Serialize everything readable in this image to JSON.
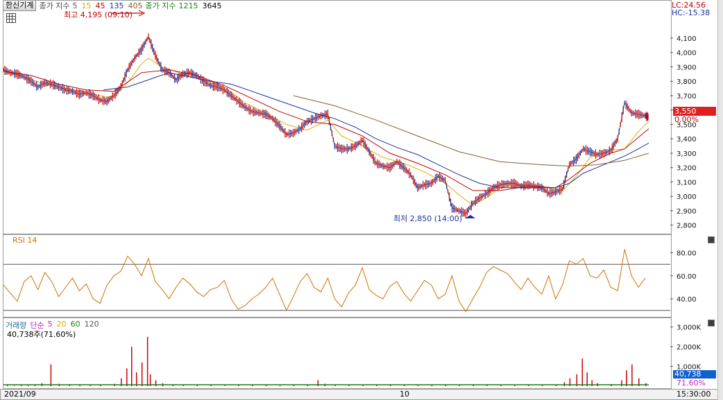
{
  "header": {
    "stock_button": "한신기계",
    "indicator_label": "종가 지수",
    "ma_periods": [
      {
        "text": "5",
        "color": "#555555"
      },
      {
        "text": "15",
        "color": "#d9b000"
      },
      {
        "text": "45",
        "color": "#c00000"
      },
      {
        "text": "135",
        "color": "#1a2fa0"
      },
      {
        "text": "405",
        "color": "#8a5a2a"
      }
    ],
    "indicator_label2": "종가 지수",
    "ma_periods2": [
      {
        "text": "1215",
        "color": "#1a7a1a"
      },
      {
        "text": "3645",
        "color": "#000000"
      }
    ]
  },
  "price_annotations": {
    "high": "최고 4,195 (09:10)",
    "low": "최저 2,850 (14:00)",
    "lc": "LC:24.56",
    "hc": "HC:-15.38",
    "current_price": "3,550",
    "current_change": "0.00%"
  },
  "rsi": {
    "title": "RSI 14"
  },
  "volume": {
    "title": "거래량",
    "ma_label": "단순",
    "ma_periods": [
      {
        "text": "5",
        "color": "#c020c0"
      },
      {
        "text": "20",
        "color": "#d9b000"
      },
      {
        "text": "60",
        "color": "#1a7a1a"
      },
      {
        "text": "120",
        "color": "#555555"
      }
    ],
    "current_volume": "40,738주(71.60%)",
    "current_badge": "40,738",
    "current_pct": "71.60%"
  },
  "x_axis": {
    "start": "2021/09",
    "mid": "10",
    "end": "15:30:00"
  },
  "chart_data": [
    {
      "type": "line",
      "title": "",
      "ylim": [
        2760,
        4230
      ],
      "y_ticks": [
        "4,100",
        "4,000",
        "3,900",
        "3,800",
        "3,700",
        "3,600",
        "3,500",
        "3,400",
        "3,300",
        "3,200",
        "3,100",
        "3,000",
        "2,900",
        "2,800"
      ],
      "series": [
        {
          "name": "5",
          "color": "#7a7a7a",
          "x": [
            0,
            10,
            20,
            30,
            40,
            50,
            60,
            70,
            80,
            90,
            100,
            110,
            120,
            130,
            140,
            150,
            160,
            170,
            180,
            190,
            200,
            210,
            220,
            230,
            240,
            250,
            260,
            270,
            280,
            290,
            300,
            310,
            320,
            330,
            340,
            350,
            360,
            370,
            380,
            390,
            400,
            410,
            420,
            430,
            440,
            450,
            460,
            470,
            480,
            490,
            500,
            510,
            520,
            530,
            540,
            550,
            560,
            570,
            580,
            590,
            600,
            610,
            620,
            630,
            640,
            650,
            660,
            670,
            680,
            690,
            700,
            710,
            720,
            730,
            740,
            750,
            760,
            770,
            780,
            790,
            800,
            810,
            820,
            830,
            840,
            850,
            860,
            870,
            880,
            890,
            900,
            910,
            920,
            930,
            935
          ],
          "values": [
            3880,
            3860,
            3850,
            3830,
            3800,
            3760,
            3790,
            3780,
            3760,
            3740,
            3730,
            3710,
            3720,
            3700,
            3670,
            3660,
            3700,
            3760,
            3880,
            3960,
            4020,
            4110,
            3980,
            3880,
            3860,
            3810,
            3850,
            3860,
            3840,
            3800,
            3770,
            3760,
            3740,
            3700,
            3660,
            3620,
            3590,
            3580,
            3570,
            3540,
            3490,
            3430,
            3440,
            3470,
            3520,
            3540,
            3560,
            3570,
            3350,
            3330,
            3330,
            3350,
            3390,
            3310,
            3230,
            3210,
            3200,
            3240,
            3200,
            3150,
            3060,
            3080,
            3090,
            3140,
            3110,
            2920,
            2900,
            2880,
            2950,
            2990,
            3020,
            3060,
            3080,
            3090,
            3090,
            3070,
            3080,
            3070,
            3060,
            3020,
            3030,
            3050,
            3220,
            3260,
            3330,
            3310,
            3290,
            3300,
            3320,
            3400,
            3650,
            3580,
            3570,
            3560,
            3550
          ]
        },
        {
          "name": "15",
          "color": "#d9b000",
          "x": [
            0,
            30,
            60,
            90,
            120,
            150,
            160,
            180,
            200,
            210,
            230,
            260,
            290,
            320,
            350,
            380,
            410,
            440,
            470,
            490,
            520,
            550,
            580,
            610,
            640,
            660,
            680,
            700,
            720,
            750,
            780,
            810,
            830,
            850,
            880,
            900,
            920,
            935
          ],
          "values": [
            3870,
            3830,
            3780,
            3750,
            3720,
            3690,
            3700,
            3790,
            3920,
            3960,
            3900,
            3850,
            3810,
            3760,
            3650,
            3580,
            3500,
            3460,
            3530,
            3420,
            3350,
            3270,
            3230,
            3170,
            3090,
            3010,
            2940,
            2990,
            3060,
            3080,
            3070,
            3040,
            3140,
            3270,
            3320,
            3330,
            3450,
            3520
          ]
        },
        {
          "name": "45",
          "color": "#c00000",
          "x": [
            0,
            40,
            80,
            120,
            160,
            200,
            240,
            280,
            320,
            360,
            400,
            440,
            480,
            520,
            560,
            600,
            640,
            680,
            720,
            760,
            800,
            820,
            850,
            880,
            900,
            920,
            935
          ],
          "values": [
            3870,
            3840,
            3780,
            3740,
            3730,
            3860,
            3880,
            3840,
            3770,
            3680,
            3590,
            3520,
            3500,
            3420,
            3300,
            3230,
            3150,
            3040,
            3040,
            3070,
            3060,
            3120,
            3230,
            3300,
            3330,
            3410,
            3470
          ]
        },
        {
          "name": "135",
          "color": "#1a2fa0",
          "x": [
            145,
            180,
            210,
            240,
            270,
            300,
            330,
            360,
            390,
            420,
            450,
            480,
            510,
            540,
            570,
            600,
            630,
            660,
            690,
            720,
            760,
            800,
            820,
            840,
            860,
            880,
            900,
            920,
            935
          ],
          "values": [
            3740,
            3760,
            3810,
            3860,
            3830,
            3800,
            3780,
            3730,
            3680,
            3630,
            3580,
            3540,
            3480,
            3400,
            3340,
            3290,
            3220,
            3150,
            3090,
            3060,
            3060,
            3060,
            3090,
            3160,
            3200,
            3240,
            3280,
            3330,
            3370
          ]
        },
        {
          "name": "405",
          "color": "#8a5a2a",
          "x": [
            420,
            480,
            540,
            600,
            660,
            720,
            780,
            820,
            860,
            900,
            935
          ],
          "values": [
            3700,
            3630,
            3530,
            3420,
            3310,
            3240,
            3220,
            3210,
            3220,
            3250,
            3300
          ]
        }
      ]
    },
    {
      "type": "line",
      "title": "RSI 14",
      "ylim": [
        25,
        90
      ],
      "y_ticks": [
        "80.00",
        "60.00",
        "40.00"
      ],
      "guides": [
        70,
        30
      ],
      "series": [
        {
          "name": "RSI 14",
          "color": "#d07000",
          "x": [
            0,
            10,
            20,
            30,
            40,
            50,
            60,
            70,
            80,
            90,
            100,
            110,
            120,
            130,
            140,
            150,
            160,
            170,
            180,
            190,
            200,
            210,
            220,
            230,
            240,
            250,
            260,
            270,
            280,
            290,
            300,
            310,
            320,
            330,
            340,
            350,
            360,
            370,
            380,
            390,
            400,
            410,
            420,
            430,
            440,
            450,
            460,
            470,
            480,
            490,
            500,
            510,
            520,
            530,
            540,
            550,
            560,
            570,
            580,
            590,
            600,
            610,
            620,
            630,
            640,
            650,
            660,
            670,
            680,
            690,
            700,
            710,
            720,
            730,
            740,
            750,
            760,
            770,
            780,
            790,
            800,
            810,
            820,
            830,
            840,
            850,
            860,
            870,
            880,
            890,
            900,
            910,
            920,
            930
          ],
          "values": [
            52,
            45,
            38,
            55,
            60,
            48,
            63,
            55,
            42,
            50,
            58,
            47,
            53,
            40,
            36,
            52,
            60,
            64,
            77,
            70,
            60,
            75,
            55,
            48,
            40,
            50,
            58,
            53,
            46,
            42,
            48,
            50,
            56,
            40,
            31,
            34,
            40,
            44,
            50,
            58,
            44,
            30,
            42,
            55,
            62,
            50,
            46,
            58,
            40,
            33,
            45,
            52,
            67,
            48,
            43,
            40,
            51,
            55,
            45,
            38,
            47,
            56,
            52,
            40,
            44,
            60,
            38,
            29,
            40,
            50,
            63,
            68,
            65,
            62,
            55,
            48,
            58,
            50,
            44,
            60,
            40,
            52,
            73,
            70,
            75,
            60,
            58,
            65,
            50,
            47,
            83,
            60,
            50,
            58
          ]
        }
      ]
    },
    {
      "type": "bar",
      "title": "거래량",
      "ylim": [
        0,
        3200
      ],
      "y_ticks": [
        "3,000K",
        "2,000K",
        "1,000K"
      ],
      "series": [
        {
          "name": "거래량",
          "color": "#cc0000",
          "x": [
            5,
            15,
            25,
            35,
            45,
            55,
            68,
            80,
            95,
            110,
            125,
            140,
            160,
            170,
            178,
            185,
            192,
            200,
            208,
            212,
            220,
            230,
            245,
            260,
            280,
            300,
            320,
            340,
            360,
            380,
            400,
            420,
            440,
            455,
            465,
            480,
            500,
            520,
            540,
            560,
            580,
            600,
            620,
            640,
            660,
            680,
            700,
            720,
            740,
            760,
            780,
            800,
            812,
            820,
            830,
            838,
            845,
            852,
            860,
            880,
            895,
            902,
            910,
            920,
            930
          ],
          "values": [
            50,
            30,
            80,
            40,
            60,
            150,
            1100,
            120,
            90,
            60,
            40,
            80,
            120,
            400,
            900,
            2000,
            700,
            1200,
            2500,
            600,
            300,
            150,
            80,
            60,
            50,
            70,
            40,
            60,
            80,
            50,
            40,
            60,
            80,
            300,
            120,
            60,
            50,
            40,
            70,
            60,
            50,
            40,
            80,
            60,
            50,
            90,
            60,
            50,
            40,
            60,
            50,
            80,
            200,
            400,
            600,
            1400,
            700,
            300,
            150,
            100,
            300,
            800,
            1100,
            400,
            150
          ]
        }
      ]
    }
  ]
}
